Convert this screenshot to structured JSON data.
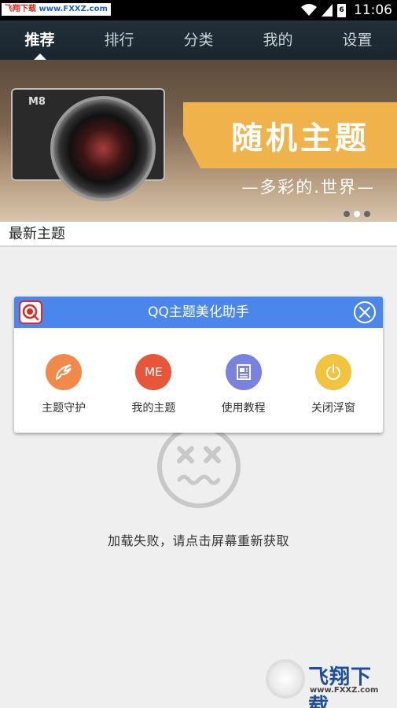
{
  "status_bar": {
    "watermark_text_a": "飞翔下载",
    "watermark_text_b": "www.FXXZ.com",
    "time": "11:06",
    "battery_level": "6"
  },
  "nav": {
    "tabs": [
      {
        "label": "推荐",
        "active": true
      },
      {
        "label": "排行",
        "active": false
      },
      {
        "label": "分类",
        "active": false
      },
      {
        "label": "我的",
        "active": false
      },
      {
        "label": "设置",
        "active": false
      }
    ]
  },
  "banner": {
    "camera_label": "M8",
    "title": "随机主题",
    "subtitle": "—多彩的.世界—",
    "active_dot": 1
  },
  "section": {
    "title": "最新主题"
  },
  "dialog": {
    "title": "QQ主题美化助手",
    "actions": [
      {
        "label": "主题守护",
        "icon": "wing-icon",
        "color": "#f2894a"
      },
      {
        "label": "我的主题",
        "icon_text": "ME",
        "color": "#e8563a"
      },
      {
        "label": "使用教程",
        "icon": "document-icon",
        "color": "#7a82e0"
      },
      {
        "label": "关闭浮窗",
        "icon": "power-icon",
        "color": "#f2c33c"
      }
    ],
    "header_color": "#4a86ec"
  },
  "error": {
    "message": "加载失败，请点击屏幕重新获取"
  },
  "watermark": {
    "brand": "飞翔下载",
    "url": "www.FXXZ.com"
  }
}
